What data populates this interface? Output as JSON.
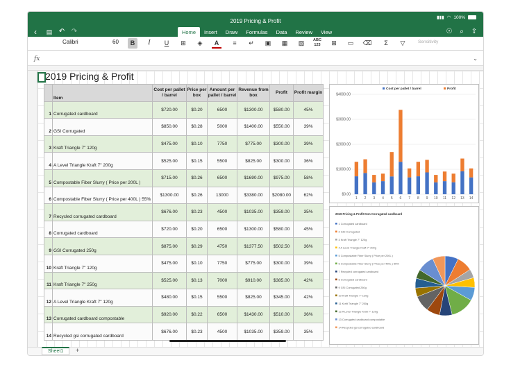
{
  "window": {
    "title": "2019 Pricing & Profit"
  },
  "status": {
    "battery": "100%",
    "signal": "▮▮▮",
    "wifi": "◠"
  },
  "tabs": [
    {
      "label": "Home",
      "active": true
    },
    {
      "label": "Insert",
      "active": false
    },
    {
      "label": "Draw",
      "active": false
    },
    {
      "label": "Formulas",
      "active": false
    },
    {
      "label": "Data",
      "active": false
    },
    {
      "label": "Review",
      "active": false
    },
    {
      "label": "View",
      "active": false
    }
  ],
  "ribbon": {
    "font_name": "Calibri",
    "font_size": "60",
    "bold": "B",
    "italic": "I",
    "underline": "U",
    "sensitivity": "Sensitivity"
  },
  "formula_bar": {
    "fx": "fx",
    "value": ""
  },
  "sheet": {
    "title": "2019 Pricing & Profit",
    "headers": [
      "Item",
      "Cost per pallet / barrel",
      "Price per box",
      "Amount per pallet / barrel",
      "Revenue from box",
      "Profit",
      "Profit margin"
    ],
    "rows": [
      {
        "num": "1",
        "item": "Corrugated cardboard",
        "cost": "$720.00",
        "price": "$0.20",
        "amount": "6500",
        "revenue": "$1300.00",
        "profit": "$580.00",
        "margin": "45%"
      },
      {
        "num": "2",
        "item": "GSI Corrugated",
        "cost": "$850.00",
        "price": "$0.28",
        "amount": "5000",
        "revenue": "$1400.00",
        "profit": "$550.00",
        "margin": "39%"
      },
      {
        "num": "3",
        "item": "Kraft Triangle 7\" 120g",
        "cost": "$475.00",
        "price": "$0.10",
        "amount": "7750",
        "revenue": "$775.00",
        "profit": "$300.00",
        "margin": "39%"
      },
      {
        "num": "4",
        "item": "A Level Triangle Kraft 7\" 200g",
        "cost": "$525.00",
        "price": "$0.15",
        "amount": "5500",
        "revenue": "$825.00",
        "profit": "$300.00",
        "margin": "36%"
      },
      {
        "num": "5",
        "item": "Compostable Fiber Slurry ( Price per 200L )",
        "cost": "$715.00",
        "price": "$0.26",
        "amount": "6500",
        "revenue": "$1690.00",
        "profit": "$975.00",
        "margin": "58%"
      },
      {
        "num": "6",
        "item": "Compostable Fiber Slurry ( Price per 400L ) 55%",
        "cost": "$1300.00",
        "price": "$0.26",
        "amount": "13000",
        "revenue": "$3380.00",
        "profit": "$2080.00",
        "margin": "62%"
      },
      {
        "num": "7",
        "item": "Recycled corrugated cardboard",
        "cost": "$676.00",
        "price": "$0.23",
        "amount": "4500",
        "revenue": "$1035.00",
        "profit": "$359.00",
        "margin": "35%"
      },
      {
        "num": "8",
        "item": "Corrugated cardboard",
        "cost": "$720.00",
        "price": "$0.20",
        "amount": "6500",
        "revenue": "$1300.00",
        "profit": "$580.00",
        "margin": "45%"
      },
      {
        "num": "9",
        "item": "GSI Corrugated 250g",
        "cost": "$875.00",
        "price": "$0.29",
        "amount": "4750",
        "revenue": "$1377.50",
        "profit": "$502.50",
        "margin": "36%"
      },
      {
        "num": "10",
        "item": "Kraft Triangle 7\" 120g",
        "cost": "$475.00",
        "price": "$0.10",
        "amount": "7750",
        "revenue": "$775.00",
        "profit": "$300.00",
        "margin": "39%"
      },
      {
        "num": "11",
        "item": "Kraft Triangle 7\" 250g",
        "cost": "$525.00",
        "price": "$0.13",
        "amount": "7000",
        "revenue": "$910.00",
        "profit": "$385.00",
        "margin": "42%"
      },
      {
        "num": "12",
        "item": "A Level Triangle Kraft 7\" 120g",
        "cost": "$480.00",
        "price": "$0.15",
        "amount": "5500",
        "revenue": "$825.00",
        "profit": "$345.00",
        "margin": "42%"
      },
      {
        "num": "13",
        "item": "Corrugated cardboard compostable",
        "cost": "$920.00",
        "price": "$0.22",
        "amount": "6500",
        "revenue": "$1430.00",
        "profit": "$510.00",
        "margin": "36%"
      },
      {
        "num": "14",
        "item": "Recycled gsi corrugated cardboard",
        "cost": "$676.00",
        "price": "$0.23",
        "amount": "4500",
        "revenue": "$1035.00",
        "profit": "$359.00",
        "margin": "35%"
      }
    ]
  },
  "sheet_tabs": {
    "active": "Sheet1",
    "add": "+"
  },
  "chart_data": [
    {
      "type": "bar",
      "stacked": true,
      "categories": [
        "1",
        "2",
        "3",
        "4",
        "5",
        "6",
        "7",
        "8",
        "9",
        "10",
        "11",
        "12",
        "13",
        "14"
      ],
      "series": [
        {
          "name": "Cost per pallet / barrel",
          "color": "#4472c4",
          "values": [
            720,
            850,
            475,
            525,
            715,
            1300,
            676,
            720,
            875,
            475,
            525,
            480,
            920,
            676
          ]
        },
        {
          "name": "Profit",
          "color": "#ed7d31",
          "values": [
            580,
            550,
            300,
            300,
            975,
            2080,
            359,
            580,
            502.5,
            300,
            385,
            345,
            510,
            359
          ]
        }
      ],
      "ylim": [
        0,
        4000
      ],
      "yticks": [
        "$0.00",
        "$1000.00",
        "$2000.00",
        "$3000.00",
        "$4000.00"
      ],
      "yvalues": [
        0,
        1000,
        2000,
        3000,
        4000
      ],
      "legend": "top-right",
      "grid": true
    },
    {
      "type": "pie",
      "title": "2019 Pricing & Profit Item Corrugated cardboard",
      "labels": [
        "1 Corrugated cardboard",
        "2 GSI Corrugated",
        "3 Kraft Triangle 7\" 120g",
        "4 A Level Triangle Kraft 7\" 200g",
        "5 Compostable Fiber Slurry ( Price per 200L )",
        "6 Compostable Fiber Slurry ( Price per 400L ) 55%",
        "7 Recycled corrugated cardboard",
        "8 Corrugated cardboard",
        "9 GSI Corrugated 250g",
        "10 Kraft Triangle 7\" 120g",
        "11 Kraft Triangle 7\" 250g",
        "12 A Level Triangle Kraft 7\" 120g",
        "13 Corrugated cardboard compostable",
        "14 Recycled gsi corrugated cardboard"
      ],
      "values": [
        720,
        850,
        475,
        525,
        715,
        1300,
        676,
        720,
        875,
        475,
        525,
        480,
        920,
        676
      ],
      "colors": [
        "#4472c4",
        "#ed7d31",
        "#a5a5a5",
        "#ffc000",
        "#5b9bd5",
        "#70ad47",
        "#264478",
        "#9e480e",
        "#636363",
        "#997300",
        "#255e91",
        "#43682b",
        "#698ed0",
        "#f1975a"
      ],
      "legend": "left"
    }
  ]
}
